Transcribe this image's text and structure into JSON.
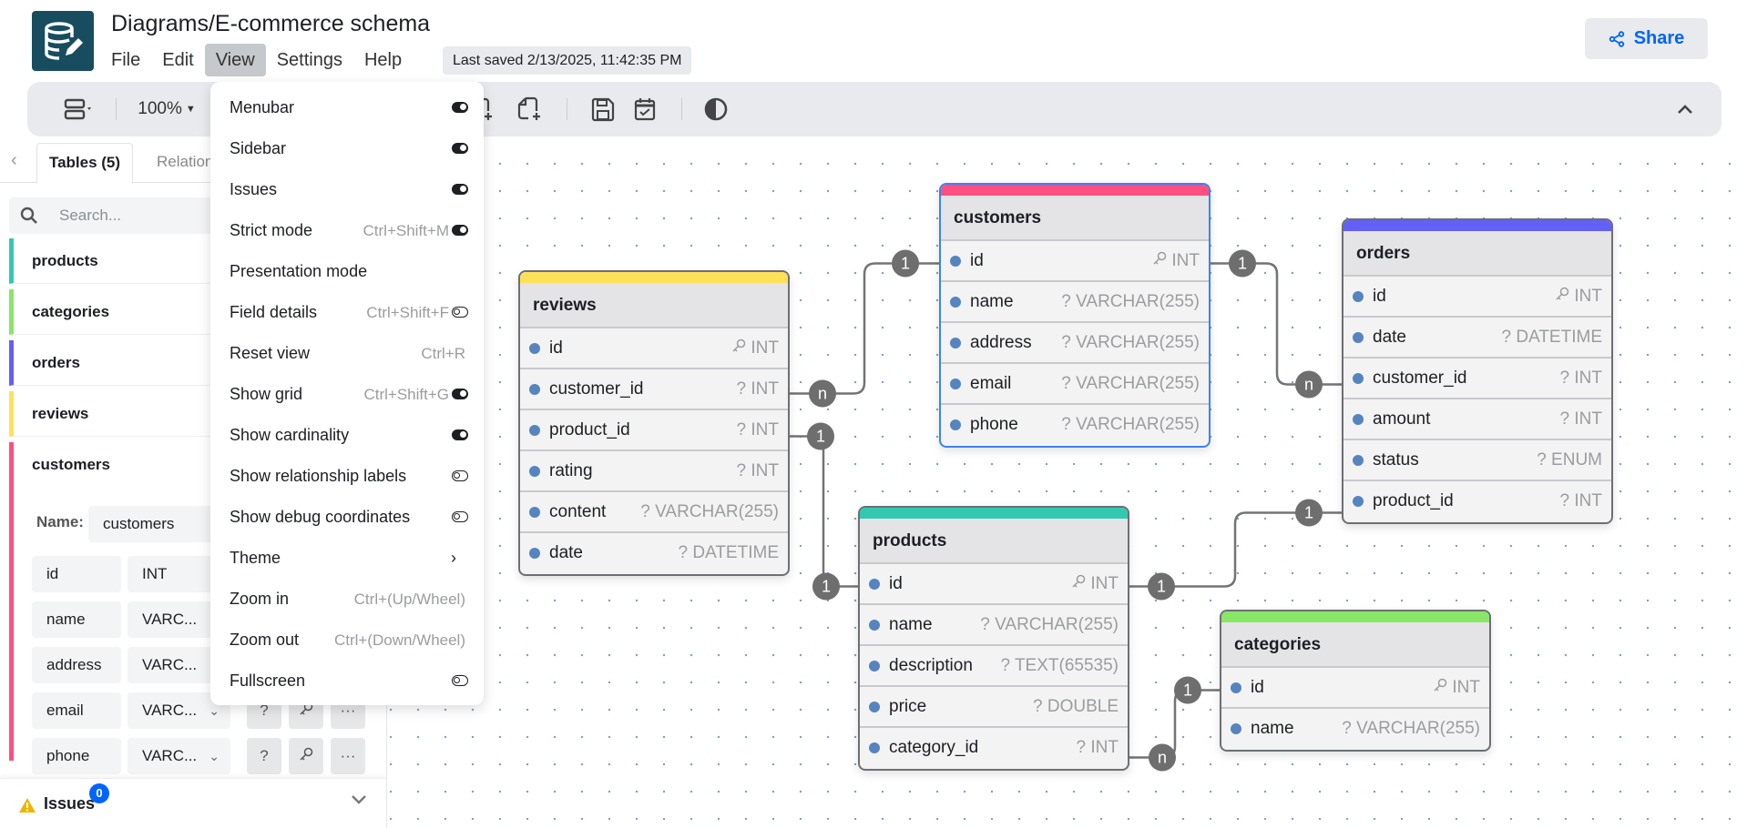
{
  "app": {
    "title": "Diagrams/E-commerce schema",
    "menus": [
      "File",
      "Edit",
      "View",
      "Settings",
      "Help"
    ],
    "active_menu": "View",
    "last_saved": "Last saved 2/13/2025, 11:42:35 PM",
    "share_label": "Share"
  },
  "toolbar": {
    "zoom_level": "100%",
    "icons": [
      "layout-icon",
      "add-table-icon",
      "add-note-icon",
      "save-icon",
      "todo-icon",
      "theme-contrast-icon"
    ]
  },
  "sidebar": {
    "tabs": [
      "Tables (5)",
      "Relationships"
    ],
    "tab_relations_visible": "Relation",
    "search_placeholder": "Search...",
    "tables": [
      {
        "name": "products",
        "color": "#32c9b0"
      },
      {
        "name": "categories",
        "color": "#89e667"
      },
      {
        "name": "orders",
        "color": "#6360f7"
      },
      {
        "name": "reviews",
        "color": "#ffe159"
      },
      {
        "name": "customers",
        "color": "#ff4f81"
      }
    ],
    "editor": {
      "name_label": "Name:",
      "name_value": "customers",
      "fields": [
        {
          "name": "id",
          "type": "INT"
        },
        {
          "name": "name",
          "type": "VARC..."
        },
        {
          "name": "address",
          "type": "VARC..."
        },
        {
          "name": "email",
          "type": "VARC..."
        },
        {
          "name": "phone",
          "type": "VARC..."
        }
      ],
      "nullable_btn": "?",
      "more_btn": "···"
    },
    "issues": {
      "label": "Issues",
      "count": "0"
    }
  },
  "view_menu": [
    {
      "label": "Menubar",
      "shortcut": "",
      "toggle": "on"
    },
    {
      "label": "Sidebar",
      "shortcut": "",
      "toggle": "on"
    },
    {
      "label": "Issues",
      "shortcut": "",
      "toggle": "on"
    },
    {
      "label": "Strict mode",
      "shortcut": "Ctrl+Shift+M",
      "toggle": "on"
    },
    {
      "label": "Presentation mode",
      "shortcut": "",
      "toggle": "none"
    },
    {
      "label": "Field details",
      "shortcut": "Ctrl+Shift+F",
      "toggle": "off"
    },
    {
      "label": "Reset view",
      "shortcut": "Ctrl+R",
      "toggle": "none"
    },
    {
      "label": "Show grid",
      "shortcut": "Ctrl+Shift+G",
      "toggle": "on"
    },
    {
      "label": "Show cardinality",
      "shortcut": "",
      "toggle": "on"
    },
    {
      "label": "Show relationship labels",
      "shortcut": "",
      "toggle": "off"
    },
    {
      "label": "Show debug coordinates",
      "shortcut": "",
      "toggle": "off"
    },
    {
      "label": "Theme",
      "shortcut": "",
      "toggle": "submenu",
      "arrow": "›"
    },
    {
      "label": "Zoom in",
      "shortcut": "Ctrl+(Up/Wheel)",
      "toggle": "none"
    },
    {
      "label": "Zoom out",
      "shortcut": "Ctrl+(Down/Wheel)",
      "toggle": "none"
    },
    {
      "label": "Fullscreen",
      "shortcut": "",
      "toggle": "off"
    }
  ],
  "diagram": {
    "tables": [
      {
        "name": "reviews",
        "color": "#ffe159",
        "selected": false,
        "fields": [
          [
            "id",
            "INT",
            true
          ],
          [
            "customer_id",
            "? INT",
            false
          ],
          [
            "product_id",
            "? INT",
            false
          ],
          [
            "rating",
            "? INT",
            false
          ],
          [
            "content",
            "? VARCHAR(255)",
            false
          ],
          [
            "date",
            "? DATETIME",
            false
          ]
        ]
      },
      {
        "name": "customers",
        "color": "#ff4f81",
        "selected": true,
        "fields": [
          [
            "id",
            "INT",
            true
          ],
          [
            "name",
            "? VARCHAR(255)",
            false
          ],
          [
            "address",
            "? VARCHAR(255)",
            false
          ],
          [
            "email",
            "? VARCHAR(255)",
            false
          ],
          [
            "phone",
            "? VARCHAR(255)",
            false
          ]
        ]
      },
      {
        "name": "orders",
        "color": "#6360f7",
        "selected": false,
        "fields": [
          [
            "id",
            "INT",
            true
          ],
          [
            "date",
            "? DATETIME",
            false
          ],
          [
            "customer_id",
            "? INT",
            false
          ],
          [
            "amount",
            "? INT",
            false
          ],
          [
            "status",
            "? ENUM",
            false
          ],
          [
            "product_id",
            "? INT",
            false
          ]
        ]
      },
      {
        "name": "products",
        "color": "#32c9b0",
        "selected": false,
        "fields": [
          [
            "id",
            "INT",
            true
          ],
          [
            "name",
            "? VARCHAR(255)",
            false
          ],
          [
            "description",
            "? TEXT(65535)",
            false
          ],
          [
            "price",
            "? DOUBLE",
            false
          ],
          [
            "category_id",
            "? INT",
            false
          ]
        ]
      },
      {
        "name": "categories",
        "color": "#89e667",
        "selected": false,
        "fields": [
          [
            "id",
            "INT",
            true
          ],
          [
            "name",
            "? VARCHAR(255)",
            false
          ]
        ]
      }
    ],
    "relationships": [
      {
        "from": "reviews.customer_id",
        "to": "customers.id",
        "from_card": "n",
        "to_card": "1"
      },
      {
        "from": "reviews.product_id",
        "to": "products.id",
        "from_card": "1",
        "to_card": "1"
      },
      {
        "from": "orders.customer_id",
        "to": "customers.id",
        "from_card": "n",
        "to_card": "1"
      },
      {
        "from": "orders.product_id",
        "to": "products.id",
        "from_card": "1",
        "to_card": "1"
      },
      {
        "from": "products.category_id",
        "to": "categories.id",
        "from_card": "n",
        "to_card": "1"
      }
    ]
  }
}
